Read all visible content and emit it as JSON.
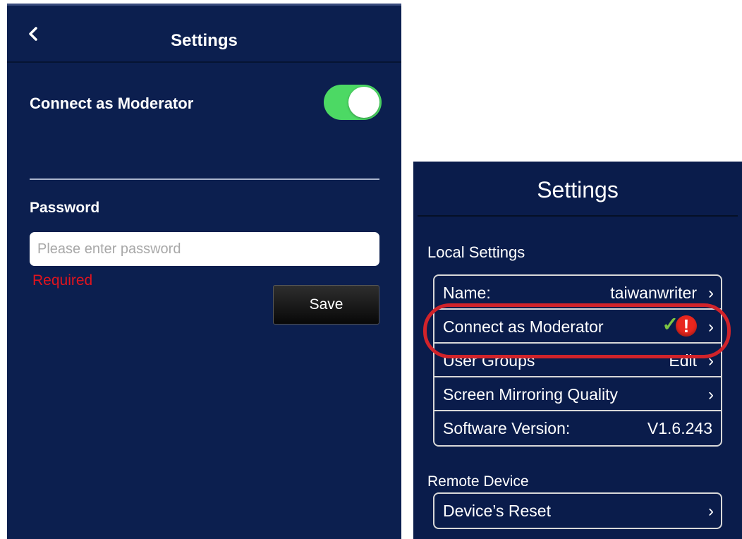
{
  "left_screen": {
    "title": "Settings",
    "back_icon": "chevron-left-icon",
    "moderator_label": "Connect as Moderator",
    "moderator_enabled": true,
    "toggle_color": "#4cd964",
    "password_label": "Password",
    "password_value": "",
    "password_placeholder": "Please enter password",
    "error_text": "Required",
    "error_color": "#e0141e",
    "save_label": "Save"
  },
  "right_screen": {
    "title": "Settings",
    "local_section": "Local Settings",
    "items": [
      {
        "label": "Name:",
        "value": "taiwanwriter",
        "chevron": "›"
      },
      {
        "label": "Connect as Moderator",
        "check_icon": "✓",
        "alert_icon": "!",
        "chevron": "›"
      },
      {
        "label": "User Groups",
        "value": "Edit",
        "chevron": "›"
      },
      {
        "label": "Screen Mirroring Quality",
        "chevron": "›"
      },
      {
        "label": "Software Version:",
        "value": "V1.6.243"
      }
    ],
    "remote_section": "Remote Device",
    "remote_items": [
      {
        "label": "Device’s Reset",
        "chevron": "›"
      }
    ],
    "highlight_color": "#d1232a"
  }
}
